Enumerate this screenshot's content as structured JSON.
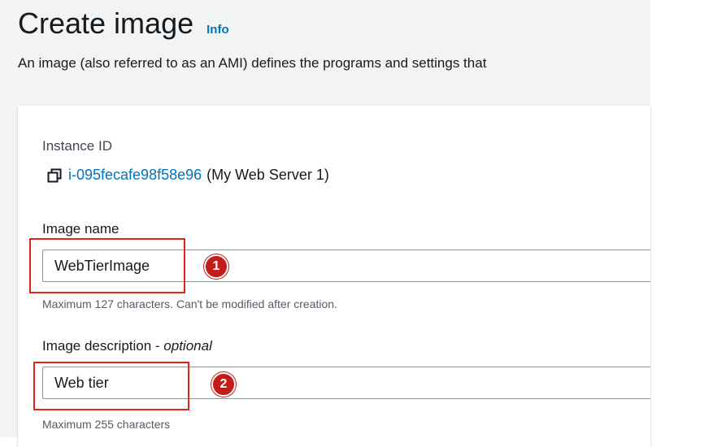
{
  "header": {
    "title": "Create image",
    "info_link": "Info",
    "description": "An image (also referred to as an AMI) defines the programs and settings that"
  },
  "instance": {
    "label": "Instance ID",
    "id_link": "i-095fecafe98f58e96",
    "name_suffix": "(My Web Server 1)",
    "icon": "copy-icon"
  },
  "image_name": {
    "label": "Image name",
    "value": "WebTierImage",
    "hint": "Maximum 127 characters. Can't be modified after creation.",
    "step_badge": "1"
  },
  "image_description": {
    "label": "Image description - ",
    "label_optional": "optional",
    "value": "Web tier",
    "hint": "Maximum 255 characters",
    "step_badge": "2"
  },
  "colors": {
    "link": "#0073bb",
    "annotation_red": "#e2231a",
    "badge_red": "#c41b1b",
    "page_bg": "#f2f3f3"
  }
}
